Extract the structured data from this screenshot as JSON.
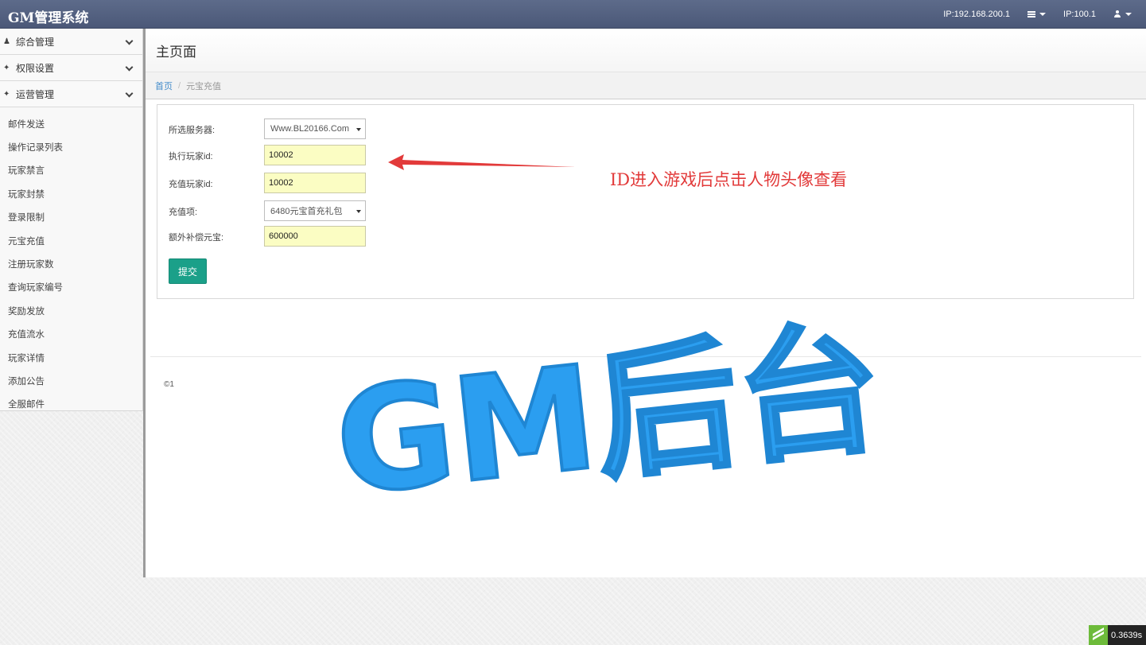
{
  "app": {
    "title": "GM管理系统"
  },
  "topbar": {
    "ip_primary": "IP:192.168.200.1",
    "ip_secondary": "IP:100.1"
  },
  "sidebar": {
    "groups": [
      {
        "label": "综合管理",
        "icon": "user-icon"
      },
      {
        "label": "权限设置",
        "icon": "wrench-icon"
      },
      {
        "label": "运营管理",
        "icon": "wrench-icon"
      }
    ],
    "items": [
      {
        "label": "邮件发送"
      },
      {
        "label": "操作记录列表"
      },
      {
        "label": "玩家禁言"
      },
      {
        "label": "玩家封禁"
      },
      {
        "label": "登录限制"
      },
      {
        "label": "元宝充值"
      },
      {
        "label": "注册玩家数"
      },
      {
        "label": "查询玩家编号"
      },
      {
        "label": "奖励发放"
      },
      {
        "label": "充值流水"
      },
      {
        "label": "玩家详情"
      },
      {
        "label": "添加公告"
      },
      {
        "label": "全服邮件"
      }
    ]
  },
  "page": {
    "title": "主页面"
  },
  "breadcrumb": {
    "home": "首页",
    "current": "元宝充值"
  },
  "form": {
    "server": {
      "label": "所选服务器:",
      "value": "Www.BL20166.Com"
    },
    "exec_player": {
      "label": "执行玩家id:",
      "value": "10002"
    },
    "recharge_player": {
      "label": "充值玩家id:",
      "value": "10002"
    },
    "recharge_item": {
      "label": "充值项:",
      "value": "6480元宝首充礼包"
    },
    "extra_gold": {
      "label": "额外补偿元宝:",
      "value": "600000"
    },
    "submit_label": "提交"
  },
  "footer": {
    "copyright": "©1"
  },
  "annotation": {
    "text": "ID进入游戏后点击人物头像查看",
    "color": "#e23a3a"
  },
  "watermark": {
    "text": "GM后台",
    "color": "#2b9ef0"
  },
  "perf": {
    "time": "0.3639s"
  }
}
